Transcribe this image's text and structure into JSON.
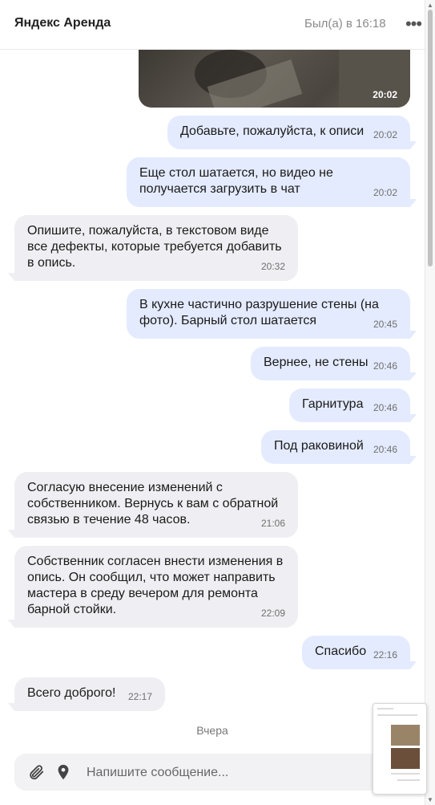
{
  "header": {
    "title": "Яндекс Аренда",
    "status": "Был(а) в 16:18",
    "more_icon": "more-dots-icon"
  },
  "photo": {
    "time": "20:02"
  },
  "messages": [
    {
      "dir": "out",
      "text": "Добавьте, пожалуйста, к описи",
      "time": "20:02"
    },
    {
      "dir": "out",
      "text": "Еще стол шатается, но видео не\nполучается загрузить в чат",
      "time": "20:02"
    },
    {
      "dir": "in",
      "text": "Опишите, пожалуйста, в текстовом виде\nвсе дефекты, которые требуется добавить\nв опись.",
      "time": "20:32"
    },
    {
      "dir": "out",
      "text": "В кухне частично разрушение стены (на\nфото). Барный стол шатается",
      "time": "20:45"
    },
    {
      "dir": "out",
      "text": "Вернее, не стены",
      "time": "20:46"
    },
    {
      "dir": "out",
      "text": "Гарнитура",
      "time": "20:46"
    },
    {
      "dir": "out",
      "text": "Под раковиной",
      "time": "20:46"
    },
    {
      "dir": "in",
      "text": "Согласую внесение изменений с\nсобственником. Вернусь к вам с обратной\nсвязью в течение 48 часов.",
      "time": "21:06"
    },
    {
      "dir": "in",
      "text": "Собственник согласен внести изменения в\nопись. Он сообщил, что может направить\nмастера в среду вечером для ремонта\nбарной стойки.",
      "time": "22:09"
    },
    {
      "dir": "out",
      "text": "Спасибо",
      "time": "22:16"
    },
    {
      "dir": "in",
      "text": "Всего доброго!",
      "time": "22:17"
    }
  ],
  "date_separator": "Вчера",
  "composer": {
    "placeholder": "Напишите сообщение...",
    "attach_icon": "paperclip-icon",
    "location_icon": "location-pin-icon"
  },
  "colors": {
    "outgoing_bubble": "#e4ebfe",
    "incoming_bubble": "#efeff3"
  }
}
